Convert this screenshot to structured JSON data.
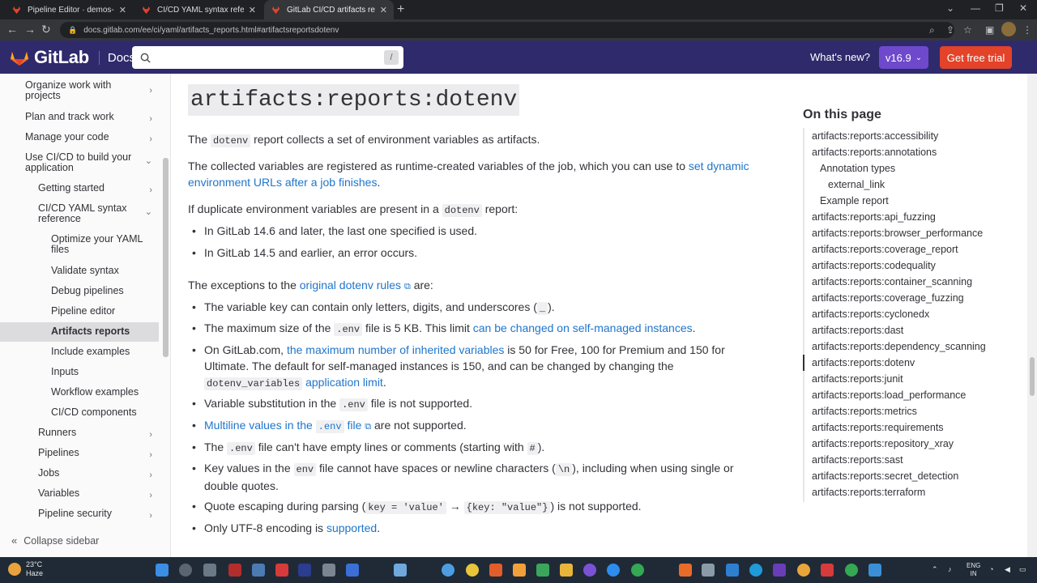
{
  "browser": {
    "tabs": [
      {
        "title": "Pipeline Editor · demos-group /",
        "close": "✕"
      },
      {
        "title": "CI/CD YAML syntax reference | G",
        "close": "✕"
      },
      {
        "title": "GitLab CI/CD artifacts reports ty",
        "close": "✕"
      }
    ],
    "new_tab": "+",
    "url": "docs.gitlab.com/ee/ci/yaml/artifacts_reports.html#artifactsreportsdotenv"
  },
  "header": {
    "logo_text": "GitLab",
    "docs_label": "Docs",
    "search_placeholder": "",
    "search_shortcut": "/",
    "whats_new": "What's new?",
    "version": "v16.9",
    "free_trial": "Get free trial"
  },
  "sidebar": {
    "items": [
      {
        "label": "Organize work with projects",
        "level": 0,
        "chev": "›"
      },
      {
        "label": "Plan and track work",
        "level": 0,
        "chev": "›"
      },
      {
        "label": "Manage your code",
        "level": 0,
        "chev": "›"
      },
      {
        "label": "Use CI/CD to build your application",
        "level": 0,
        "chev": "⌄"
      },
      {
        "label": "Getting started",
        "level": 1,
        "chev": "›"
      },
      {
        "label": "CI/CD YAML syntax reference",
        "level": 1,
        "chev": "⌄"
      },
      {
        "label": "Optimize your YAML files",
        "level": 2,
        "chev": ""
      },
      {
        "label": "Validate syntax",
        "level": 2,
        "chev": ""
      },
      {
        "label": "Debug pipelines",
        "level": 2,
        "chev": ""
      },
      {
        "label": "Pipeline editor",
        "level": 2,
        "chev": ""
      },
      {
        "label": "Artifacts reports",
        "level": 2,
        "chev": "",
        "active": true
      },
      {
        "label": "Include examples",
        "level": 2,
        "chev": ""
      },
      {
        "label": "Inputs",
        "level": 2,
        "chev": ""
      },
      {
        "label": "Workflow examples",
        "level": 2,
        "chev": ""
      },
      {
        "label": "CI/CD components",
        "level": 2,
        "chev": ""
      },
      {
        "label": "Runners",
        "level": 1,
        "chev": "›"
      },
      {
        "label": "Pipelines",
        "level": 1,
        "chev": "›"
      },
      {
        "label": "Jobs",
        "level": 1,
        "chev": "›"
      },
      {
        "label": "Variables",
        "level": 1,
        "chev": "›"
      },
      {
        "label": "Pipeline security",
        "level": 1,
        "chev": "›"
      }
    ],
    "collapse_label": "Collapse sidebar"
  },
  "content": {
    "heading": "artifacts:reports:dotenv",
    "p1": {
      "a": "The ",
      "code": "dotenv",
      "b": " report collects a set of environment variables as artifacts."
    },
    "p2": {
      "a": "The collected variables are registered as runtime-created variables of the job, which you can use to ",
      "link": "set dynamic environment URLs after a job finishes",
      "b": "."
    },
    "p3": {
      "a": "If duplicate environment variables are present in a ",
      "code": "dotenv",
      "b": " report:"
    },
    "list1": [
      "In GitLab 14.6 and later, the last one specified is used.",
      "In GitLab 14.5 and earlier, an error occurs."
    ],
    "p4": {
      "a": "The exceptions to the ",
      "link": "original dotenv rules",
      "b": " are:"
    },
    "ex1": {
      "a": "The variable key can contain only letters, digits, and underscores (",
      "code": "_",
      "b": ")."
    },
    "ex2": {
      "a": "The maximum size of the ",
      "code": ".env",
      "b": " file is 5 KB. This limit ",
      "link": "can be changed on self-managed instances",
      "c": "."
    },
    "ex3": {
      "a": "On GitLab.com, ",
      "link": "the maximum number of inherited variables",
      "b": " is 50 for Free, 100 for Premium and 150 for Ultimate. The default for self-managed instances is 150, and can be changed by changing the ",
      "code": "dotenv_variables",
      "c": " ",
      "link2": "application limit",
      "d": "."
    },
    "ex4": {
      "a": "Variable substitution in the ",
      "code": ".env",
      "b": " file is not supported."
    },
    "ex5": {
      "link": "Multiline values in the ",
      "code": ".env",
      "link_b": " file",
      "b": " are not supported."
    },
    "ex6": {
      "a": "The ",
      "code": ".env",
      "b": " file can't have empty lines or comments (starting with ",
      "code2": "#",
      "c": ")."
    },
    "ex7": {
      "a": "Key values in the ",
      "code": "env",
      "b": " file cannot have spaces or newline characters (",
      "code2": "\\n",
      "c": "), including when using single or double quotes."
    },
    "ex8": {
      "a": "Quote escaping during parsing (",
      "code": "key = 'value'",
      "b": " → ",
      "code2": "{key: \"value\"}",
      "c": ") is not supported."
    },
    "ex9": {
      "a": "Only UTF-8 encoding is ",
      "link": "supported",
      "b": "."
    }
  },
  "toc": {
    "title": "On this page",
    "items": [
      {
        "label": "artifacts:reports:accessibility",
        "indent": 0
      },
      {
        "label": "artifacts:reports:annotations",
        "indent": 0
      },
      {
        "label": "Annotation types",
        "indent": 1
      },
      {
        "label": "external_link",
        "indent": 2
      },
      {
        "label": "Example report",
        "indent": 1
      },
      {
        "label": "artifacts:reports:api_fuzzing",
        "indent": 0
      },
      {
        "label": "artifacts:reports:browser_performance",
        "indent": 0
      },
      {
        "label": "artifacts:reports:coverage_report",
        "indent": 0
      },
      {
        "label": "artifacts:reports:codequality",
        "indent": 0
      },
      {
        "label": "artifacts:reports:container_scanning",
        "indent": 0
      },
      {
        "label": "artifacts:reports:coverage_fuzzing",
        "indent": 0
      },
      {
        "label": "artifacts:reports:cyclonedx",
        "indent": 0
      },
      {
        "label": "artifacts:reports:dast",
        "indent": 0
      },
      {
        "label": "artifacts:reports:dependency_scanning",
        "indent": 0
      },
      {
        "label": "artifacts:reports:dotenv",
        "indent": 0,
        "active": true
      },
      {
        "label": "artifacts:reports:junit",
        "indent": 0
      },
      {
        "label": "artifacts:reports:load_performance",
        "indent": 0
      },
      {
        "label": "artifacts:reports:metrics",
        "indent": 0
      },
      {
        "label": "artifacts:reports:requirements",
        "indent": 0
      },
      {
        "label": "artifacts:reports:repository_xray",
        "indent": 0
      },
      {
        "label": "artifacts:reports:sast",
        "indent": 0
      },
      {
        "label": "artifacts:reports:secret_detection",
        "indent": 0
      },
      {
        "label": "artifacts:reports:terraform",
        "indent": 0
      }
    ]
  },
  "taskbar": {
    "temperature": "23°C",
    "weather": "Haze",
    "lang1": "ENG",
    "lang2": "IN"
  }
}
